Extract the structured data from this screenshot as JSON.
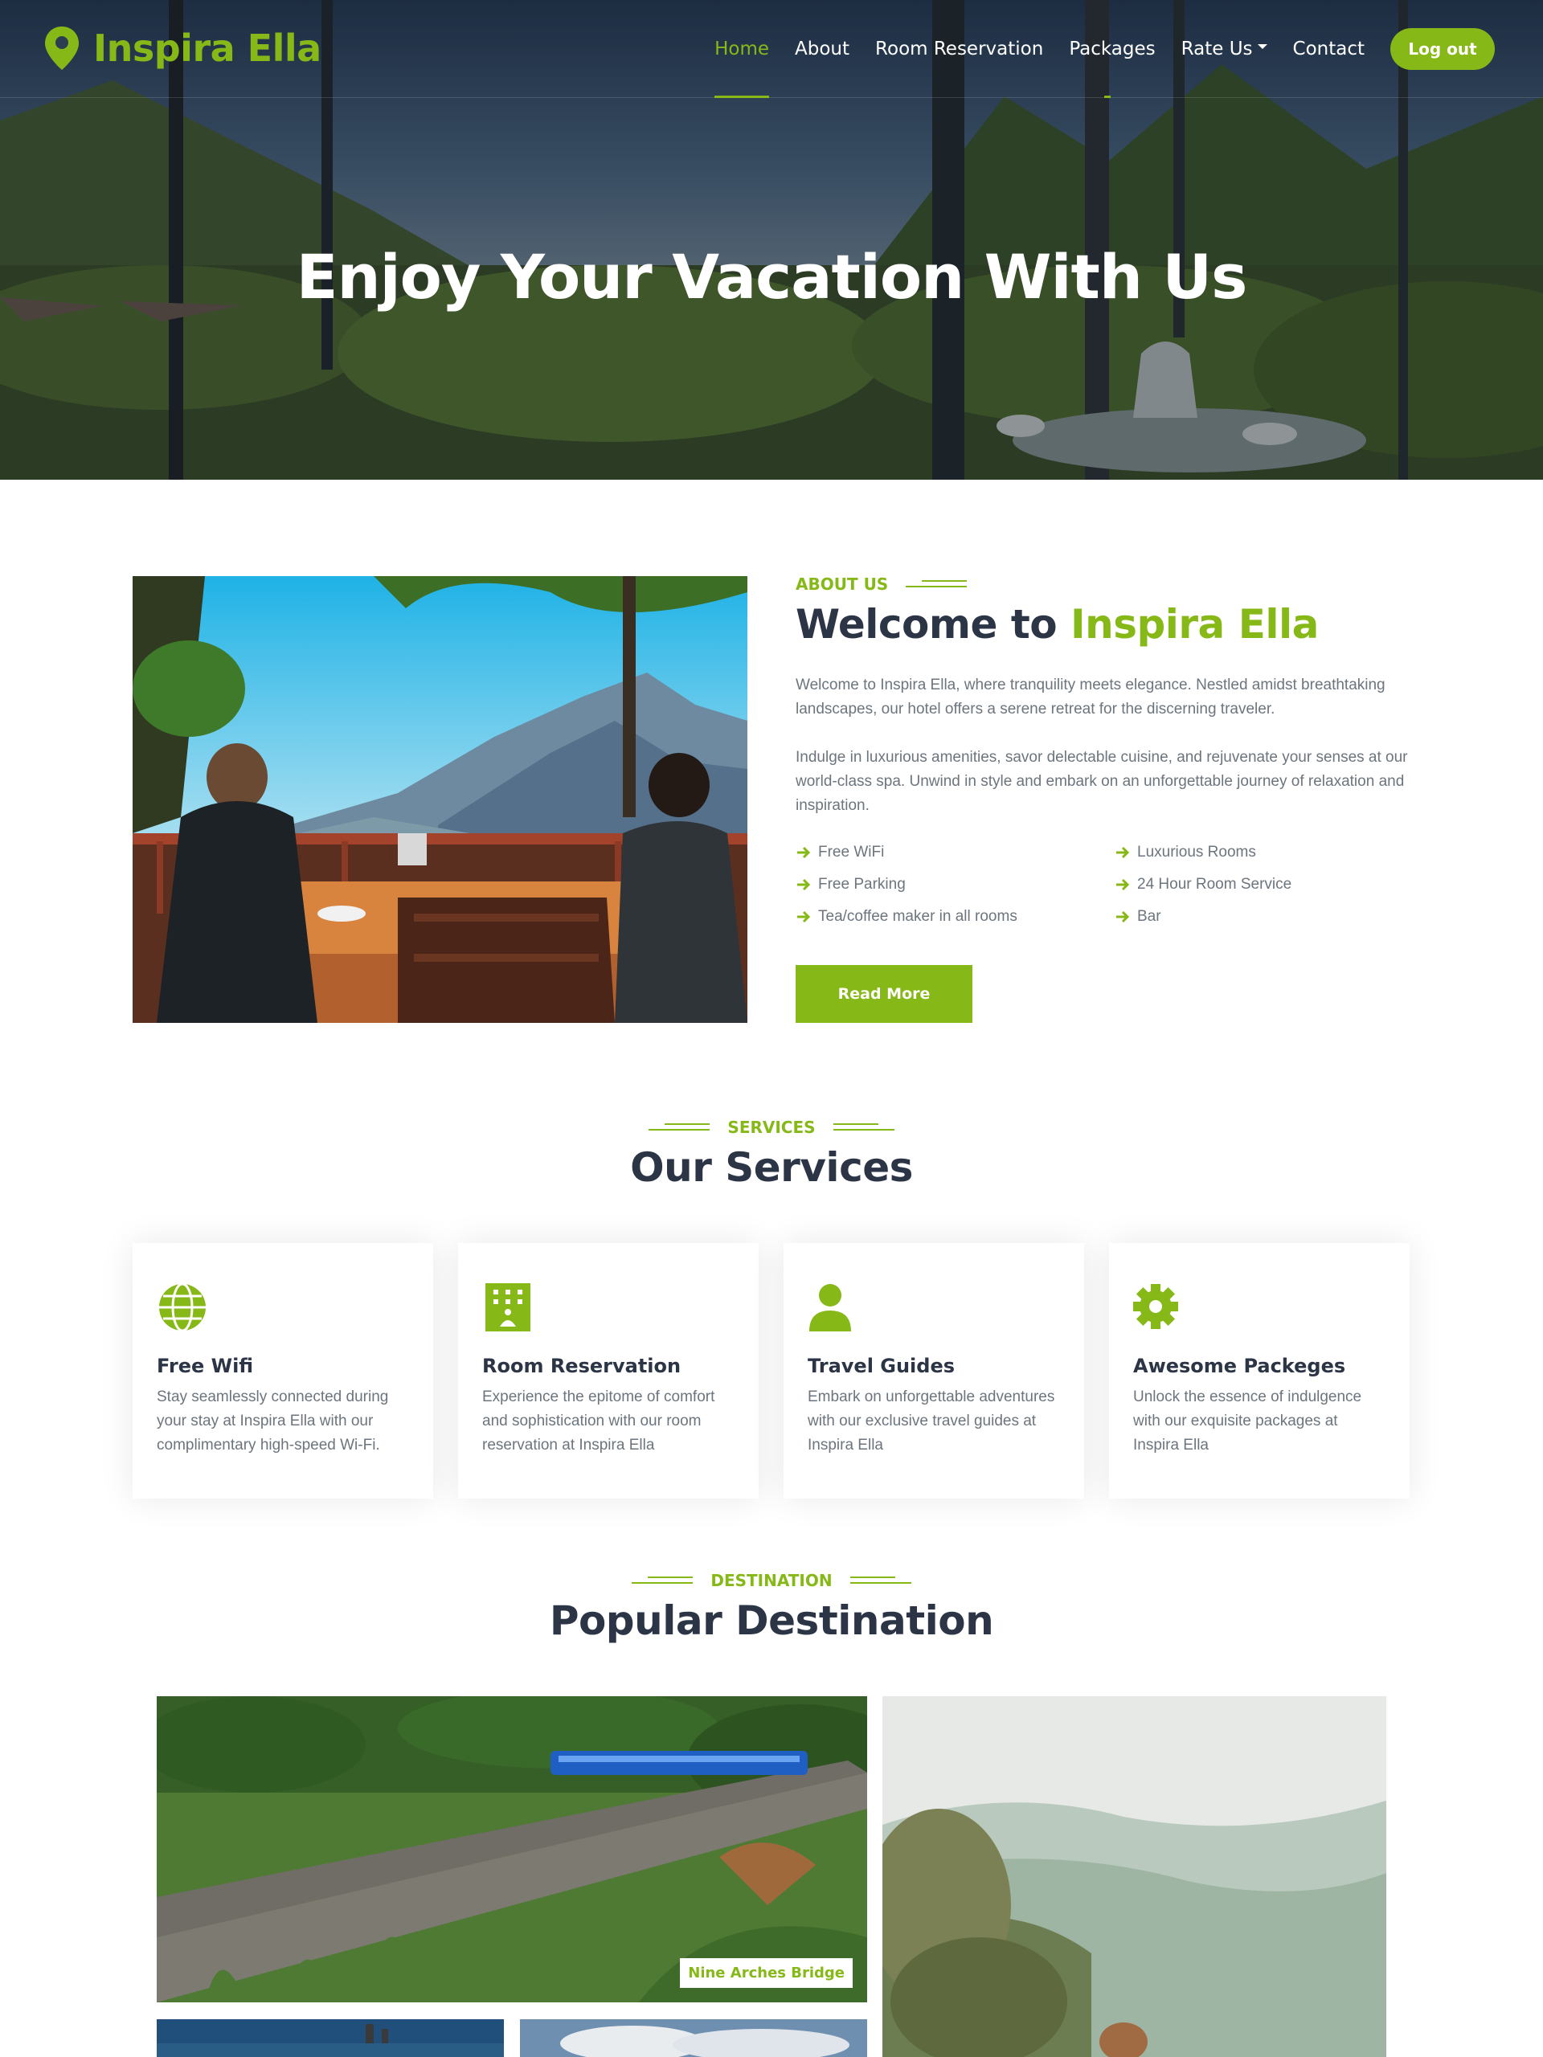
{
  "brand": {
    "name": "Inspira Ella",
    "icon": "map-marker-icon",
    "color": "#86b817"
  },
  "nav": {
    "items": [
      {
        "label": "Home",
        "active": true
      },
      {
        "label": "About",
        "active": false
      },
      {
        "label": "Room Reservation",
        "active": false
      },
      {
        "label": "Packages",
        "active": false
      },
      {
        "label": "Rate Us",
        "active": false,
        "dropdown": true
      },
      {
        "label": "Contact",
        "active": false
      }
    ],
    "logout_label": "Log out"
  },
  "hero": {
    "title": "Enjoy Your Vacation With Us"
  },
  "about": {
    "eyebrow": "About Us",
    "title_prefix": "Welcome to ",
    "title_accent": "Inspira Ella",
    "paragraph1": "Welcome to Inspira Ella, where tranquility meets elegance. Nestled amidst breathtaking landscapes, our hotel offers a serene retreat for the discerning traveler.",
    "paragraph2": "Indulge in luxurious amenities, savor delectable cuisine, and rejuvenate your senses at our world-class spa. Unwind in style and embark on an unforgettable journey of relaxation and inspiration.",
    "features": [
      "Free WiFi",
      "Luxurious Rooms",
      "Free Parking",
      "24 Hour Room Service",
      "Tea/coffee maker in all rooms",
      "Bar"
    ],
    "button_label": "Read More"
  },
  "services": {
    "eyebrow": "Services",
    "title": "Our Services",
    "cards": [
      {
        "icon": "globe-icon",
        "title": "Free Wifi",
        "text": "Stay seamlessly connected during your stay at Inspira Ella with our complimentary high-speed Wi-Fi."
      },
      {
        "icon": "hotel-icon",
        "title": "Room Reservation",
        "text": "Experience the epitome of comfort and sophistication with our room reservation at Inspira Ella"
      },
      {
        "icon": "user-icon",
        "title": "Travel Guides",
        "text": "Embark on unforgettable adventures with our exclusive travel guides at Inspira Ella"
      },
      {
        "icon": "cog-icon",
        "title": "Awesome Packeges",
        "text": "Unlock the essence of indulgence with our exquisite packages at Inspira Ella"
      }
    ]
  },
  "destination": {
    "eyebrow": "Destination",
    "title": "Popular Destination",
    "items": [
      {
        "label": "Nine Arches Bridge"
      }
    ]
  }
}
